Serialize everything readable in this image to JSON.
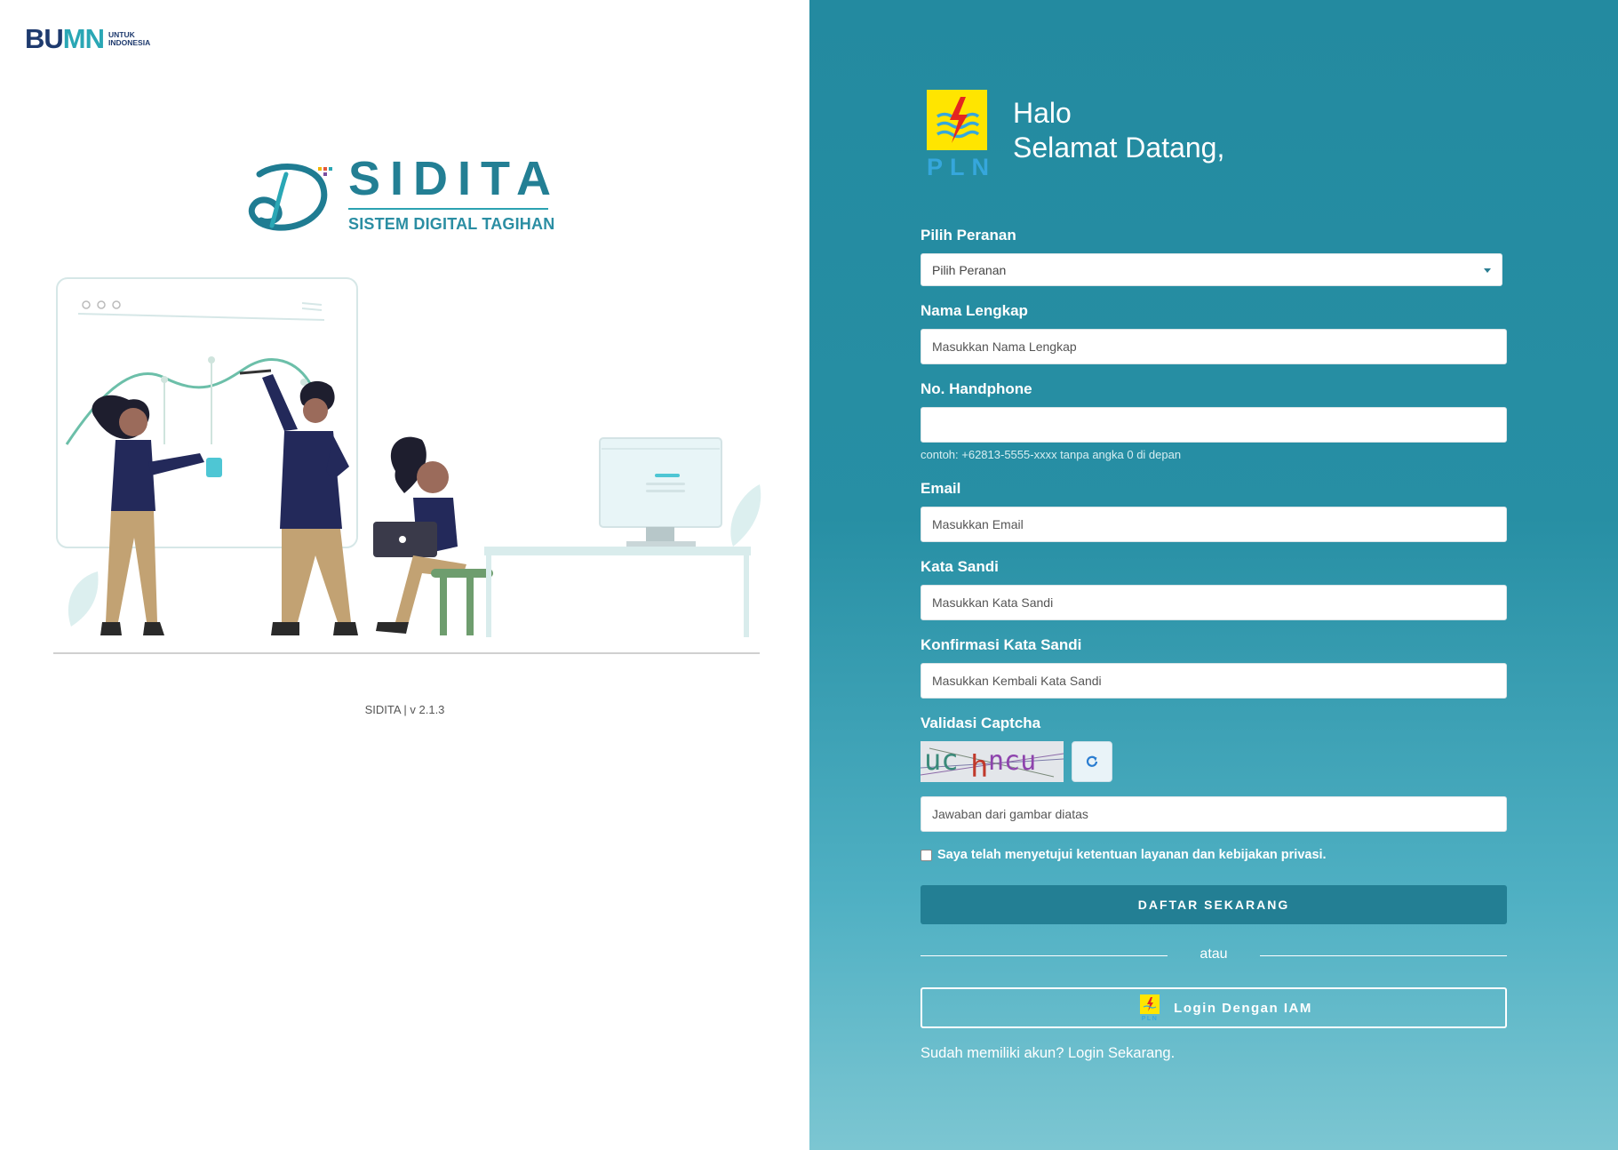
{
  "bumn_logo": {
    "mark": "BUMN",
    "sub_line1": "UNTUK",
    "sub_line2": "INDONESIA"
  },
  "brand": {
    "name": "SIDITA",
    "tagline": "SISTEM DIGITAL TAGIHAN"
  },
  "version": "SIDITA | v 2.1.3",
  "header": {
    "greeting_line1": "Halo",
    "greeting_line2": "Selamat Datang,",
    "pln_text": "PLN"
  },
  "form": {
    "role": {
      "label": "Pilih Peranan",
      "selected": "Pilih Peranan"
    },
    "full_name": {
      "label": "Nama Lengkap",
      "placeholder": "Masukkan Nama Lengkap",
      "value": ""
    },
    "phone": {
      "label": "No. Handphone",
      "placeholder": "",
      "value": "",
      "hint": "contoh: +62813-5555-xxxx tanpa angka 0 di depan"
    },
    "email": {
      "label": "Email",
      "placeholder": "Masukkan Email",
      "value": ""
    },
    "password": {
      "label": "Kata Sandi",
      "placeholder": "Masukkan Kata Sandi",
      "value": ""
    },
    "password_confirm": {
      "label": "Konfirmasi Kata Sandi",
      "placeholder": "Masukkan Kembali Kata Sandi",
      "value": ""
    },
    "captcha": {
      "label": "Validasi Captcha",
      "image_text": "uchncu",
      "answer_placeholder": "Jawaban dari gambar diatas"
    },
    "agree_label": "Saya telah menyetujui ketentuan layanan dan kebijakan privasi.",
    "submit_label": "DAFTAR SEKARANG",
    "divider_text": "atau",
    "iam_label": "Login Dengan IAM",
    "have_account_text": "Sudah memiliki akun? Login Sekarang."
  },
  "colors": {
    "primary": "#237f94",
    "panel_top": "#238aa0",
    "panel_bottom": "#7cc6d2",
    "pln_yellow": "#ffe500"
  }
}
